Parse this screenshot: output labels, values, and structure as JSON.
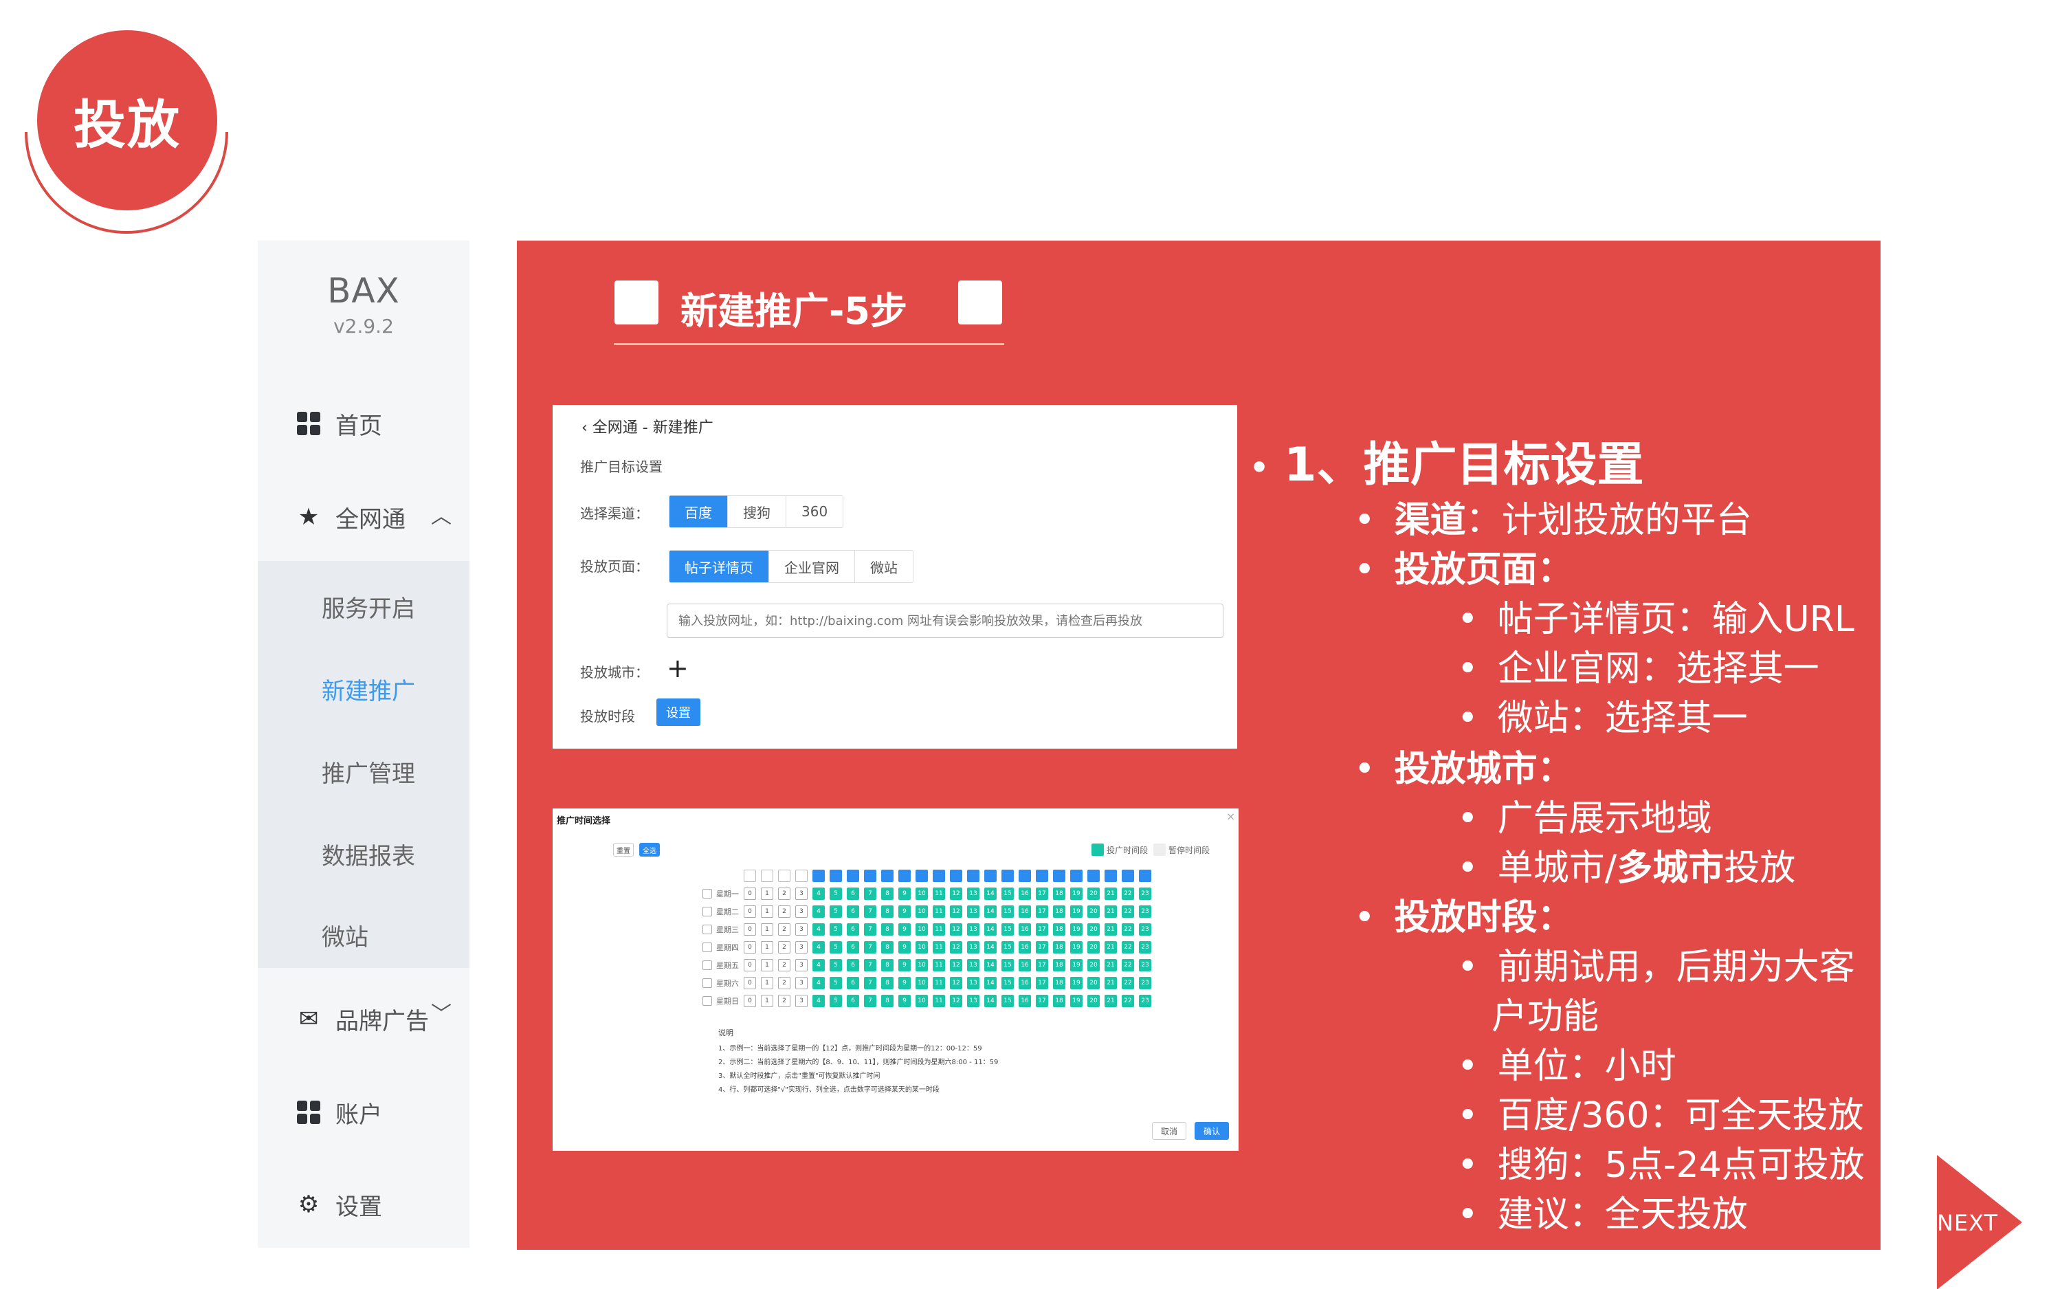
{
  "badge": {
    "label": "投放"
  },
  "sidebar": {
    "brand": "BAX",
    "version": "v2.9.2",
    "items": [
      {
        "label": "首页"
      },
      {
        "label": "全网通"
      },
      {
        "label": "品牌广告"
      },
      {
        "label": "账户"
      },
      {
        "label": "设置"
      }
    ],
    "sub_items": [
      {
        "label": "服务开启"
      },
      {
        "label": "新建推广"
      },
      {
        "label": "推广管理"
      },
      {
        "label": "数据报表"
      },
      {
        "label": "微站"
      }
    ]
  },
  "panel": {
    "title": "新建推广-5步"
  },
  "shot1": {
    "breadcrumb": "全网通 - 新建推广",
    "section": "推广目标设置",
    "channel_label": "选择渠道：",
    "channels": [
      "百度",
      "搜狗",
      "360"
    ],
    "page_label": "投放页面：",
    "pages": [
      "帖子详情页",
      "企业官网",
      "微站"
    ],
    "url_placeholder": "输入投放网址，如：http://baixing.com 网址有误会影响投放效果，请检查后再投放",
    "city_label": "投放城市：",
    "time_label": "投放时段",
    "set_button": "设置"
  },
  "shot2": {
    "title": "推广时间选择",
    "btn_a": "重置",
    "btn_b": "全选",
    "legend_on": "投广时间段",
    "legend_off": "暂停时间段",
    "days": [
      "星期一",
      "星期二",
      "星期三",
      "星期四",
      "星期五",
      "星期六",
      "星期日"
    ],
    "notes_title": "说明",
    "notes": [
      "1、示例一：当前选择了星期一的【12】点，则推广时间段为星期一的12：00-12：59",
      "2、示例二：当前选择了星期六的【8、9、10、11】，则推广时间段为星期六8:00 - 11：59",
      "3、默认全时段推广，点击\"重置\"可恢复默认推广时间",
      "4、行、列都可选择\"√\"实现行、列全选，点击数字可选择某天的某一时段"
    ],
    "cancel": "取消",
    "ok": "确认"
  },
  "bullets": {
    "h1": "1、推广目标设置",
    "channel_key": "渠道",
    "channel_val": "：计划投放的平台",
    "page_key": "投放页面：",
    "page_items": [
      "帖子详情页：输入URL",
      "企业官网：选择其一",
      "微站：选择其一"
    ],
    "city_key": "投放城市：",
    "city_items": [
      "广告展示地域"
    ],
    "city_multi_a": "单城市/",
    "city_multi_b": "多城市",
    "city_multi_c": "投放",
    "time_key": "投放时段：",
    "time_items": [
      "前期试用，后期为大客",
      "户功能",
      "单位：小时",
      "百度/360：可全天投放",
      "搜狗：5点-24点可投放",
      "建议：全天投放"
    ]
  },
  "next": {
    "label": "NEXT"
  },
  "colors": {
    "brand_red": "#e24a47",
    "accent_blue": "#2d8cf0",
    "time_green": "#18c6a7"
  }
}
